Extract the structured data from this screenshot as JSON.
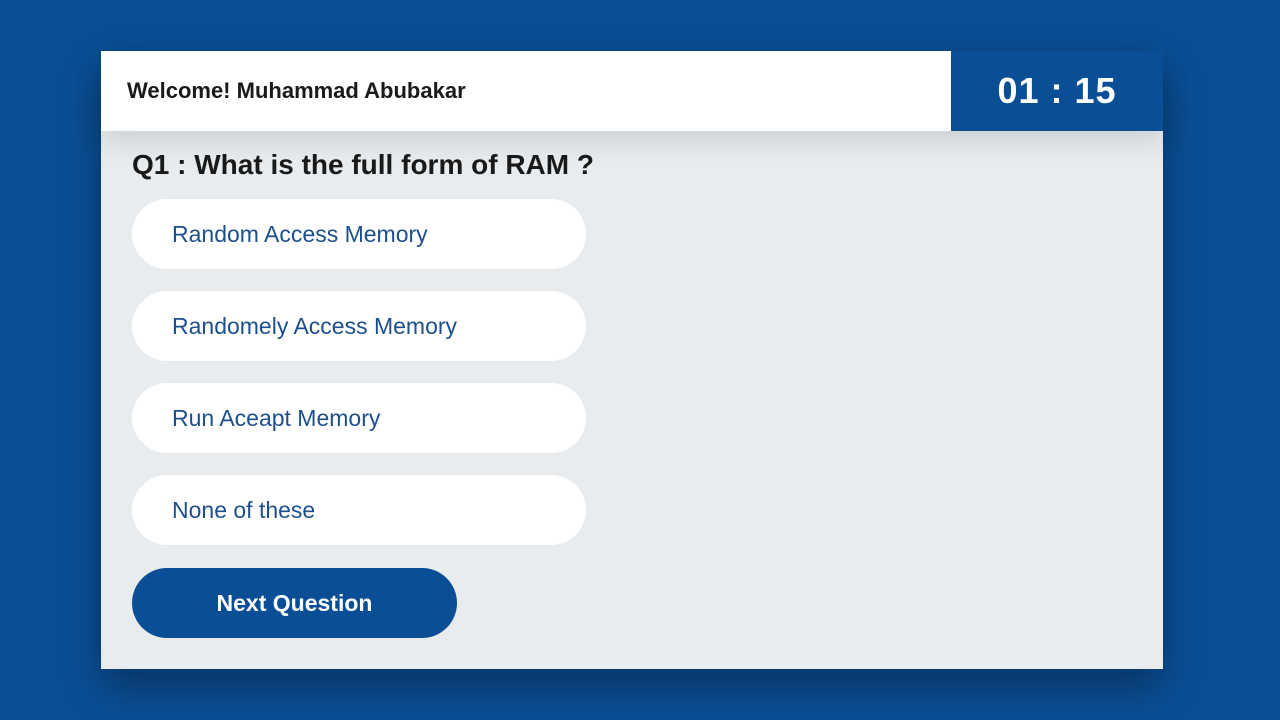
{
  "header": {
    "welcome_text": "Welcome! Muhammad Abubakar",
    "timer": "01 : 15"
  },
  "question": {
    "text": "Q1 : What is the full form of RAM ?"
  },
  "options": [
    {
      "label": "Random Access Memory"
    },
    {
      "label": "Randomely Access Memory"
    },
    {
      "label": "Run Aceapt Memory"
    },
    {
      "label": "None of these"
    }
  ],
  "next_button": {
    "label": "Next Question"
  },
  "colors": {
    "background": "#0a4f96",
    "card": "#e8ecee",
    "accent": "#0a4f96",
    "option_text": "#1d4f8c"
  }
}
